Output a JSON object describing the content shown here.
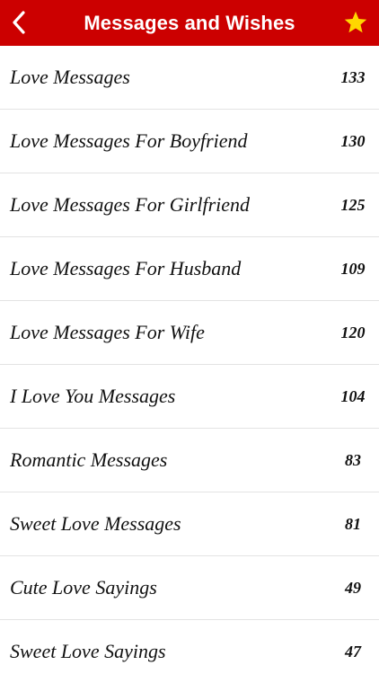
{
  "navbar": {
    "title": "Messages and Wishes",
    "back_icon": "chevron-left-icon",
    "favorite_icon": "star-icon",
    "bar_color": "#cc0000",
    "star_color": "#ffd700"
  },
  "categories": [
    {
      "label": "Love Messages",
      "count": "133"
    },
    {
      "label": "Love Messages For Boyfriend",
      "count": "130"
    },
    {
      "label": "Love Messages For Girlfriend",
      "count": "125"
    },
    {
      "label": "Love Messages For Husband",
      "count": "109"
    },
    {
      "label": "Love Messages For Wife",
      "count": "120"
    },
    {
      "label": "I Love You Messages",
      "count": "104"
    },
    {
      "label": "Romantic Messages",
      "count": "83"
    },
    {
      "label": "Sweet Love Messages",
      "count": "81"
    },
    {
      "label": "Cute Love Sayings",
      "count": "49"
    },
    {
      "label": "Sweet Love Sayings",
      "count": "47"
    }
  ]
}
